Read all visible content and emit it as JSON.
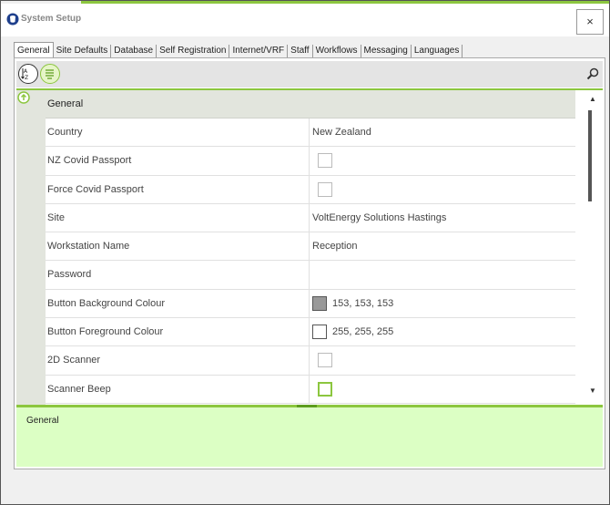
{
  "window": {
    "title": "System Setup",
    "close_label": "×"
  },
  "tabs": [
    {
      "label": "General"
    },
    {
      "label": "Site Defaults"
    },
    {
      "label": "Database"
    },
    {
      "label": "Self Registration"
    },
    {
      "label": "Internet/VRF"
    },
    {
      "label": "Staff"
    },
    {
      "label": "Workflows"
    },
    {
      "label": "Messaging"
    },
    {
      "label": "Languages"
    }
  ],
  "toolbar": {
    "sort_icon": "sort-alphabetical-icon",
    "category_icon": "categorized-icon",
    "search_icon": "search-icon"
  },
  "grid": {
    "category": "General",
    "rows": [
      {
        "name": "Country",
        "value": "New Zealand"
      },
      {
        "name": "NZ Covid Passport",
        "checked": false
      },
      {
        "name": "Force Covid Passport",
        "checked": false
      },
      {
        "name": "Site",
        "value": "VoltEnergy Solutions Hastings"
      },
      {
        "name": "Workstation Name",
        "value": "Reception"
      },
      {
        "name": "Password",
        "value": ""
      },
      {
        "name": "Button Background Colour",
        "value": "153, 153, 153",
        "swatch": "#999999"
      },
      {
        "name": "Button Foreground Colour",
        "value": "255, 255, 255",
        "swatch": "#ffffff"
      },
      {
        "name": "2D Scanner",
        "checked": false
      },
      {
        "name": "Scanner Beep",
        "checked": false
      }
    ]
  },
  "description": {
    "text": "General"
  },
  "colors": {
    "accent": "#8cc63f",
    "description_bg": "#dcffc4",
    "category_bg": "#e2e5dd"
  }
}
